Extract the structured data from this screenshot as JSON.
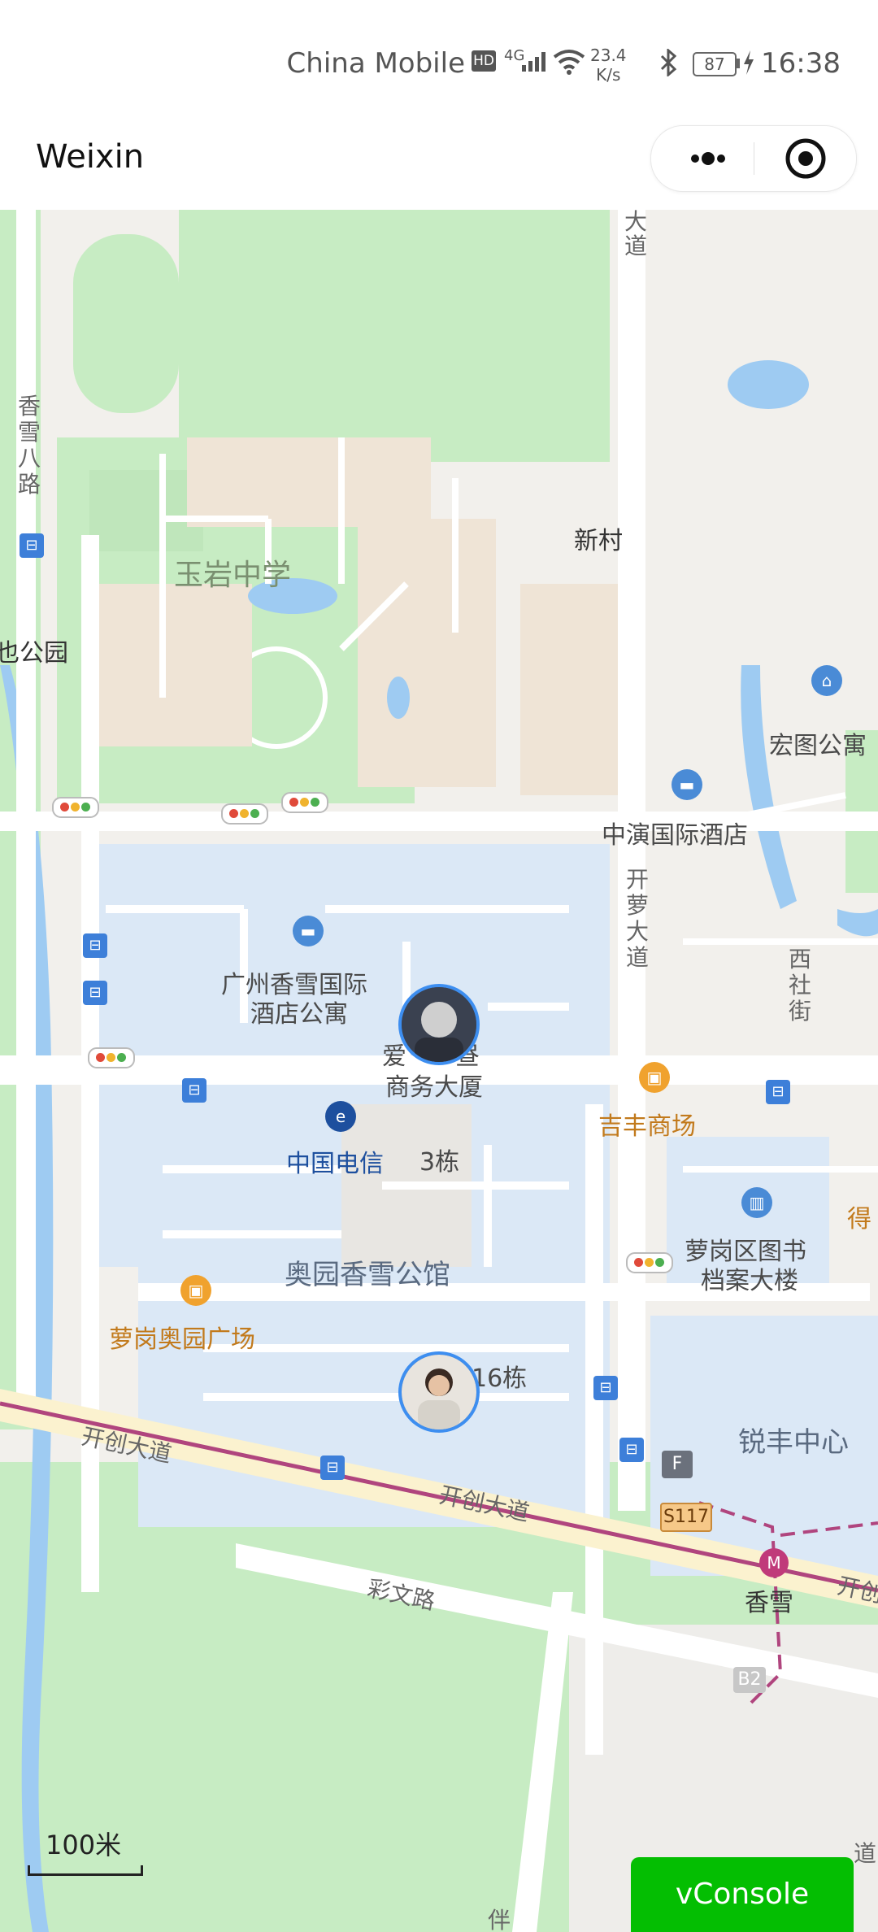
{
  "status_bar": {
    "carrier": "China Mobile",
    "hd": "HD",
    "network": "4G",
    "speed_value": "23.4",
    "speed_unit": "K/s",
    "battery": "87",
    "time": "16:38"
  },
  "nav": {
    "title": "Weixin"
  },
  "map": {
    "labels": {
      "yuyan_school": "玉岩中学",
      "xinxiang_8": "香雪八路",
      "park": "也公园",
      "xincun": "新村",
      "hongtu": "宏图公寓",
      "zhongyan_hotel": "中演国际酒店",
      "kailuo_road_v": "开萝大道",
      "xishe_street": "西社街",
      "gz_xiangxue_hotel_1": "广州香雪国际",
      "gz_xiangxue_hotel_2": "酒店公寓",
      "business_building_1": "爱　　昼",
      "business_building_2": "商务大厦",
      "jifeng_mall": "吉丰商场",
      "china_telecom": "中国电信",
      "building_3": "3栋",
      "aoyuan_apartment": "奥园香雪公馆",
      "library_1": "萝岗区图书",
      "library_2": "档案大楼",
      "de": "得",
      "aoyuan_plaza": "萝岗奥园广场",
      "building_6": "16栋",
      "ruifeng_center": "锐丰中心",
      "kaichuang_road_1": "开创大道",
      "kaichuang_road_2": "开创大道",
      "kaichuang_road_3": "开创",
      "caiwen_road": "彩文路",
      "xiangxue_station": "香雪",
      "s117": "S117",
      "b2": "B2",
      "f": "F",
      "top_road": "大道",
      "bottom_road": "伴",
      "right_road": "道"
    },
    "scale_label": "100米"
  },
  "vconsole_label": "vConsole"
}
